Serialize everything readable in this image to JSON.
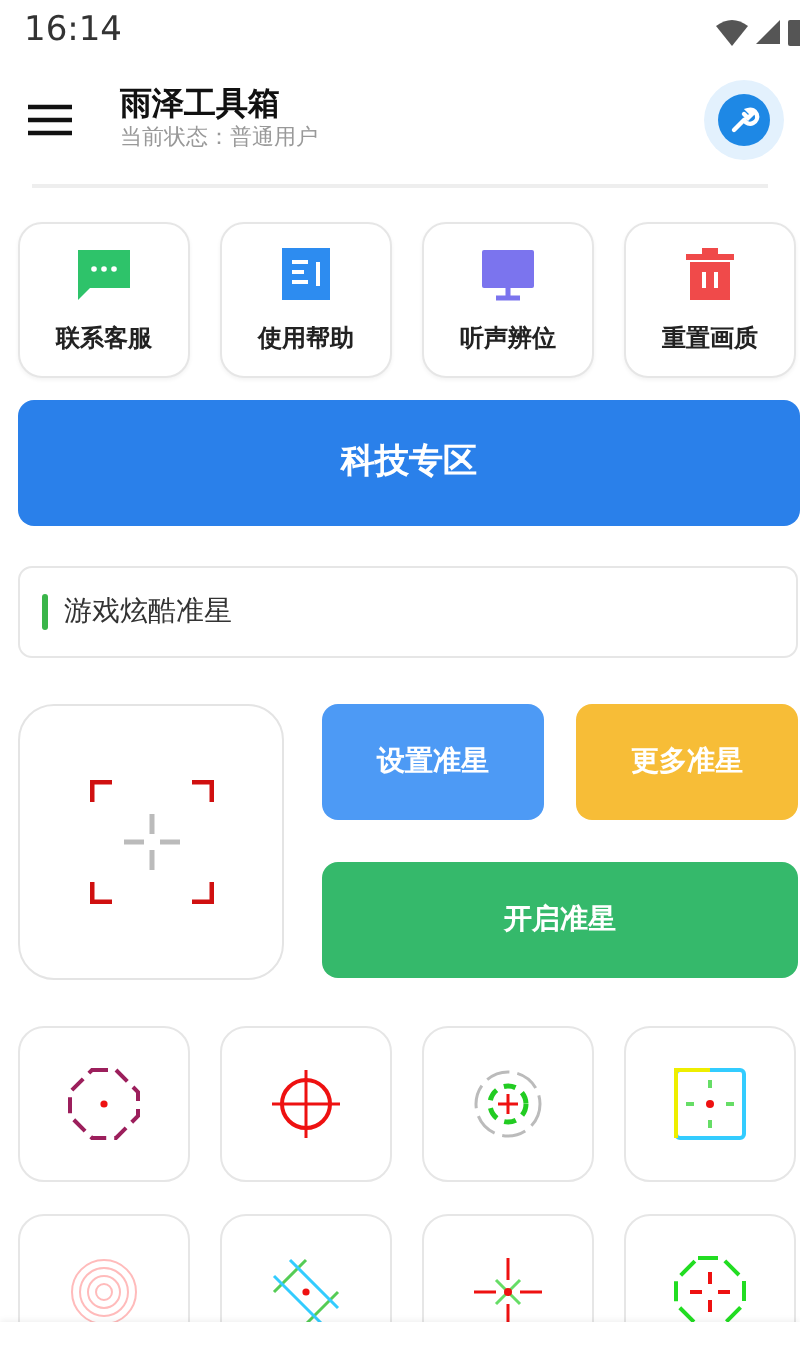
{
  "status_bar": {
    "time": "16:14"
  },
  "header": {
    "title": "雨泽工具箱",
    "subtitle": "当前状态：普通用户"
  },
  "shortcuts": [
    {
      "kind": "chat",
      "label": "联系客服"
    },
    {
      "kind": "doc",
      "label": "使用帮助"
    },
    {
      "kind": "monitor",
      "label": "听声辨位"
    },
    {
      "kind": "trash",
      "label": "重置画质"
    }
  ],
  "banner_button": "科技专区",
  "section_title": "游戏炫酷准星",
  "actions": [
    {
      "kind": "blue",
      "label": "设置准星"
    },
    {
      "kind": "yellow",
      "label": "更多准星"
    },
    {
      "kind": "green",
      "label": "开启准星"
    }
  ],
  "crosshairs": [
    {
      "kind": "octagon"
    },
    {
      "kind": "circle"
    },
    {
      "kind": "ring"
    },
    {
      "kind": "square"
    },
    {
      "kind": "rings"
    },
    {
      "kind": "diamond"
    },
    {
      "kind": "star"
    },
    {
      "kind": "octagon-green"
    }
  ]
}
